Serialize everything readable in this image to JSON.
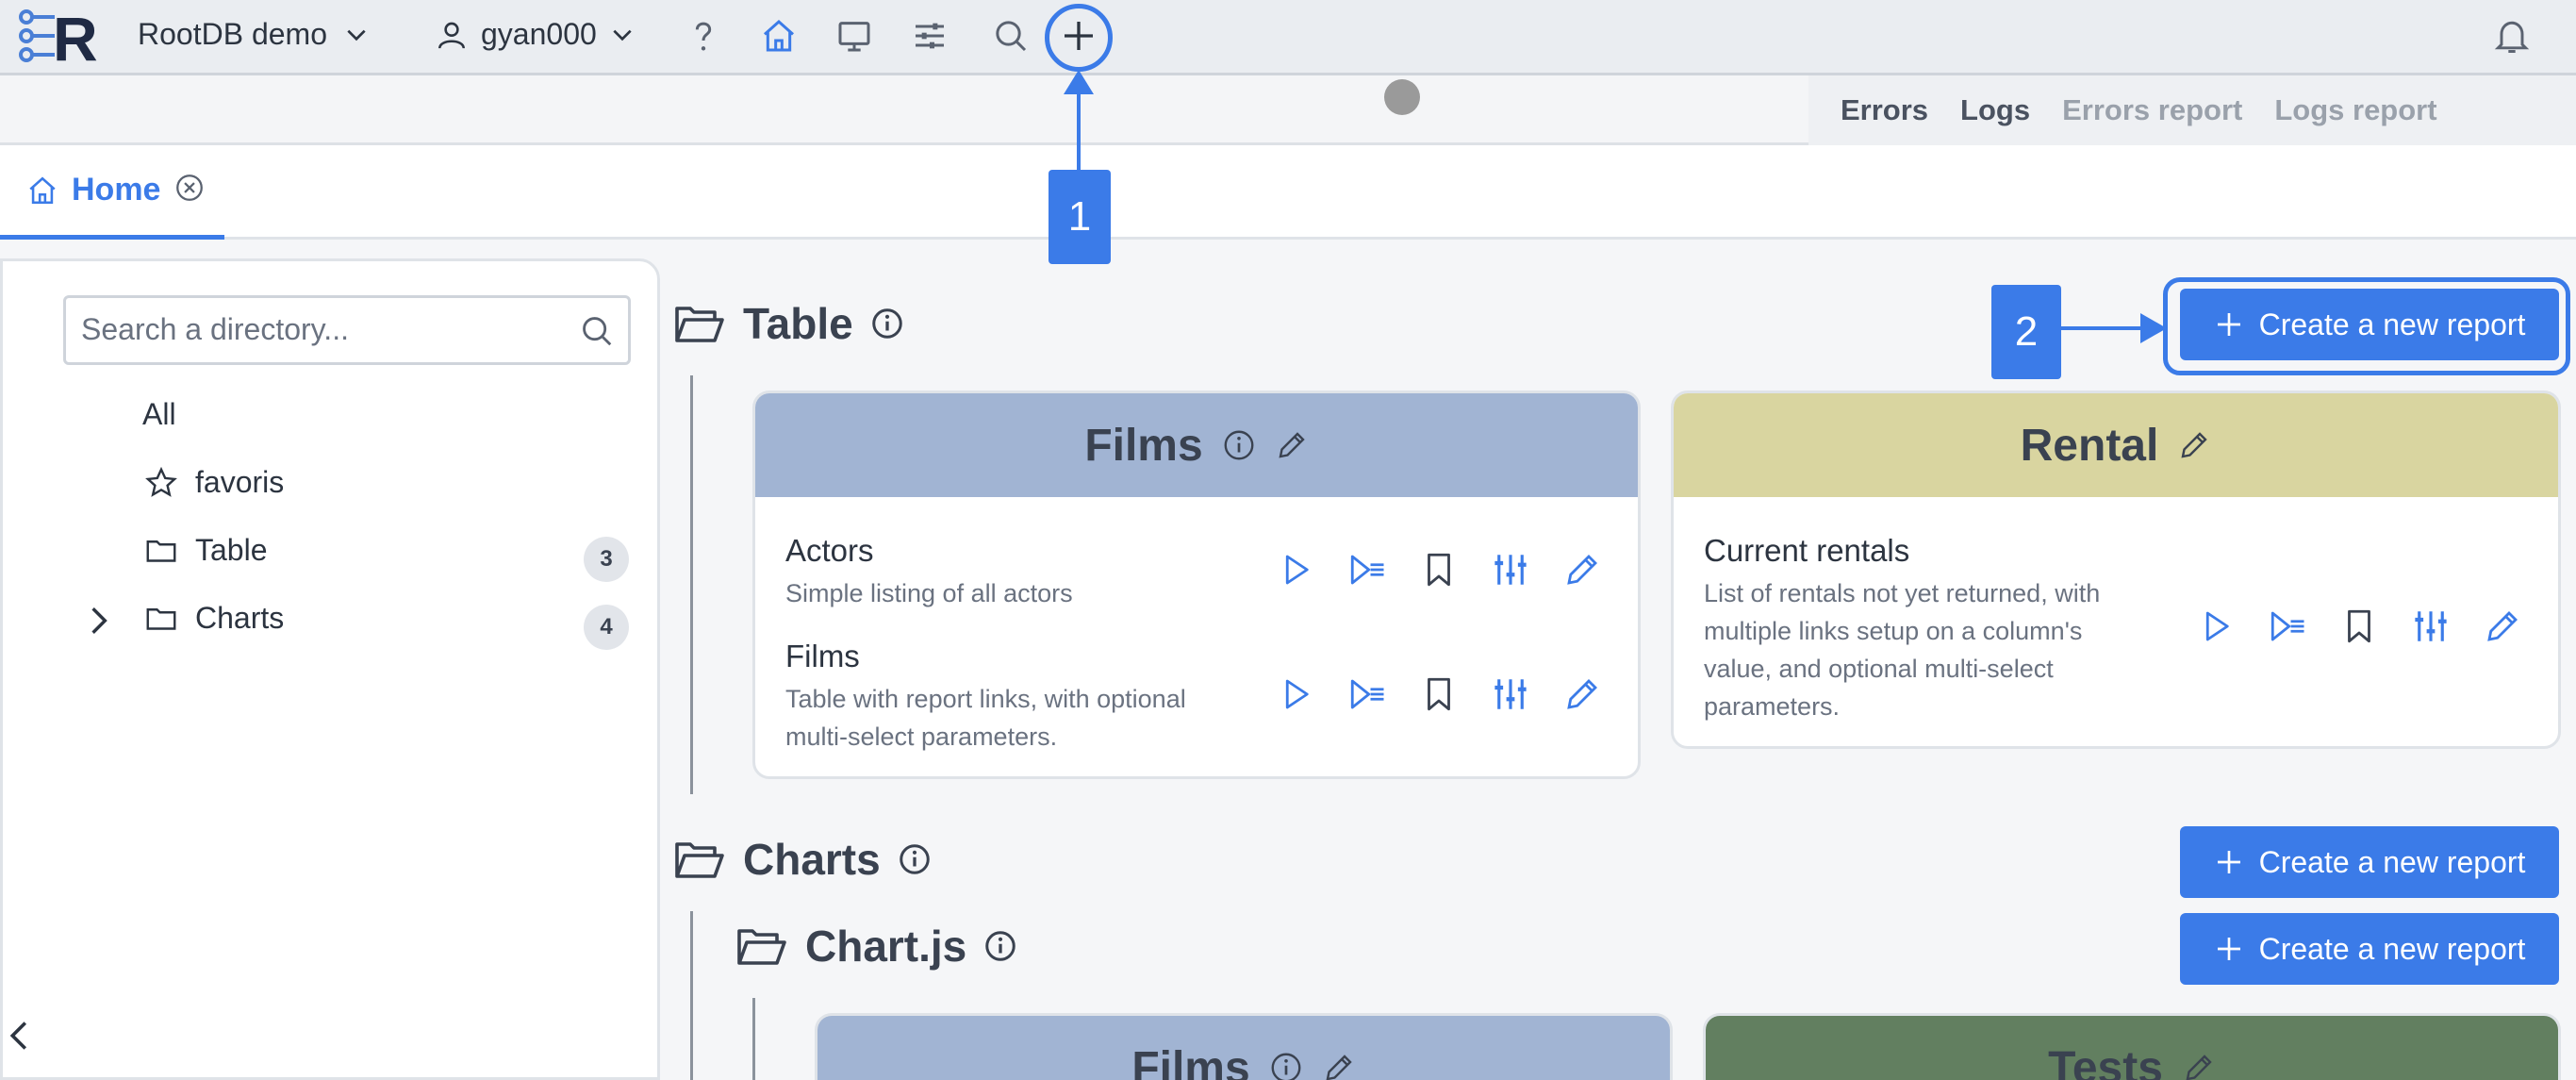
{
  "topbar": {
    "app_name": "RootDB demo",
    "username": "gyan000"
  },
  "subbar": {
    "tabs": [
      "Errors",
      "Logs",
      "Errors report",
      "Logs report"
    ]
  },
  "page_tab": {
    "label": "Home"
  },
  "annotations": {
    "first": "1",
    "second": "2"
  },
  "sidebar": {
    "search_placeholder": "Search a directory...",
    "items": [
      {
        "label": "All"
      },
      {
        "label": "favoris"
      },
      {
        "label": "Table",
        "count": "3"
      },
      {
        "label": "Charts",
        "count": "4"
      }
    ]
  },
  "sections": {
    "table": {
      "title": "Table",
      "create_label": "Create a new report",
      "cards": [
        {
          "title": "Films",
          "header_color": "#a1b4d3",
          "reports": [
            {
              "title": "Actors",
              "desc": "Simple listing of all actors"
            },
            {
              "title": "Films",
              "desc": "Table with report links, with optional multi-select parameters."
            }
          ]
        },
        {
          "title": "Rental",
          "header_color": "#d9d5a0",
          "reports": [
            {
              "title": "Current rentals",
              "desc": "List of rentals not yet returned, with multiple links setup on a column's value, and optional multi-select parameters."
            }
          ]
        }
      ]
    },
    "charts": {
      "title": "Charts",
      "create_label": "Create a new report",
      "sub": {
        "title": "Chart.js",
        "create_label": "Create a new report",
        "cards": [
          {
            "title": "Films",
            "header_color": "#a1b4d3"
          },
          {
            "title": "Tests",
            "header_color": "#627f60"
          }
        ]
      }
    }
  },
  "colors": {
    "accent": "#3b7be8"
  }
}
